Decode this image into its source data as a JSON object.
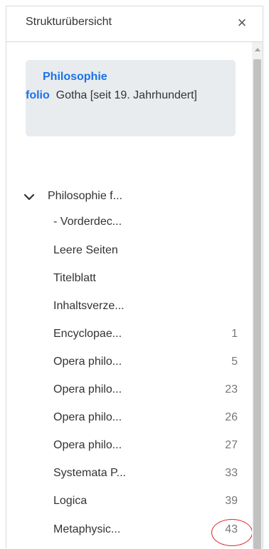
{
  "header": {
    "title": "Strukturübersicht",
    "close_label": "×"
  },
  "info": {
    "line1": "Philosophie",
    "link": "folio",
    "text": "Gotha [seit 19. Jahrhundert]"
  },
  "tree": {
    "root_label": "Philosophie f...",
    "items": [
      {
        "label": "- Vorderdec...",
        "page": ""
      },
      {
        "label": "Leere Seiten",
        "page": ""
      },
      {
        "label": "Titelblatt",
        "page": ""
      },
      {
        "label": "Inhaltsverze...",
        "page": ""
      },
      {
        "label": "Encyclopae...",
        "page": "1"
      },
      {
        "label": "Opera philo...",
        "page": "5"
      },
      {
        "label": "Opera philo...",
        "page": "23"
      },
      {
        "label": "Opera philo...",
        "page": "26"
      },
      {
        "label": "Opera philo...",
        "page": "27"
      },
      {
        "label": "Systemata P...",
        "page": "33"
      },
      {
        "label": "Logica",
        "page": "39"
      },
      {
        "label": "Metaphysic...",
        "page": "43"
      }
    ]
  },
  "colors": {
    "link": "#1a73e8",
    "highlight": "#e02020",
    "info_bg": "#e9ecef"
  },
  "icons": {
    "close": "close-icon",
    "expand": "chevron-down-icon",
    "scroll_up": "scroll-up-arrow-icon"
  }
}
